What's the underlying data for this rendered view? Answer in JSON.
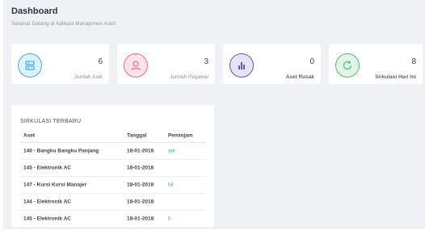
{
  "header": {
    "title": "Dashboard",
    "subtitle": "Selamat Datang di Aplikasi Manajemen Aset!"
  },
  "cards": [
    {
      "value": "6",
      "label": "Jumlah Aset",
      "icon": "server-icon",
      "color": "#3fb0e0",
      "bg": "#dcf1fb"
    },
    {
      "value": "3",
      "label": "Jumlah Pegawai",
      "icon": "user-icon",
      "color": "#f06b8b",
      "bg": "#fde3ea"
    },
    {
      "value": "0",
      "label": "Aset Rusak",
      "icon": "bar-chart-icon",
      "color": "#6b5aa6",
      "bg": "#e7e2f6"
    },
    {
      "value": "8",
      "label": "Sirkulasi Hari Ini",
      "icon": "refresh-icon",
      "color": "#4dbf72",
      "bg": "#e0f5e6"
    }
  ],
  "sirkulasi": {
    "title": "SIRKULASI TERBARU",
    "columns": [
      "Aset",
      "Tanggal",
      "Peminjam"
    ],
    "rows": [
      {
        "aset": "146 - Bangku Bangku Panjang",
        "tanggal": "18-01-2018",
        "peminjam": "adi"
      },
      {
        "aset": "145 - Elektronik AC",
        "tanggal": "18-01-2018",
        "peminjam": ""
      },
      {
        "aset": "147 - Kursi Kursi Manajer",
        "tanggal": "18-01-2018",
        "peminjam": "lol"
      },
      {
        "aset": "144 - Elektronik AC",
        "tanggal": "18-01-2018",
        "peminjam": ""
      },
      {
        "aset": "145 - Elektronik AC",
        "tanggal": "18-01-2018",
        "peminjam": "ll"
      }
    ]
  }
}
